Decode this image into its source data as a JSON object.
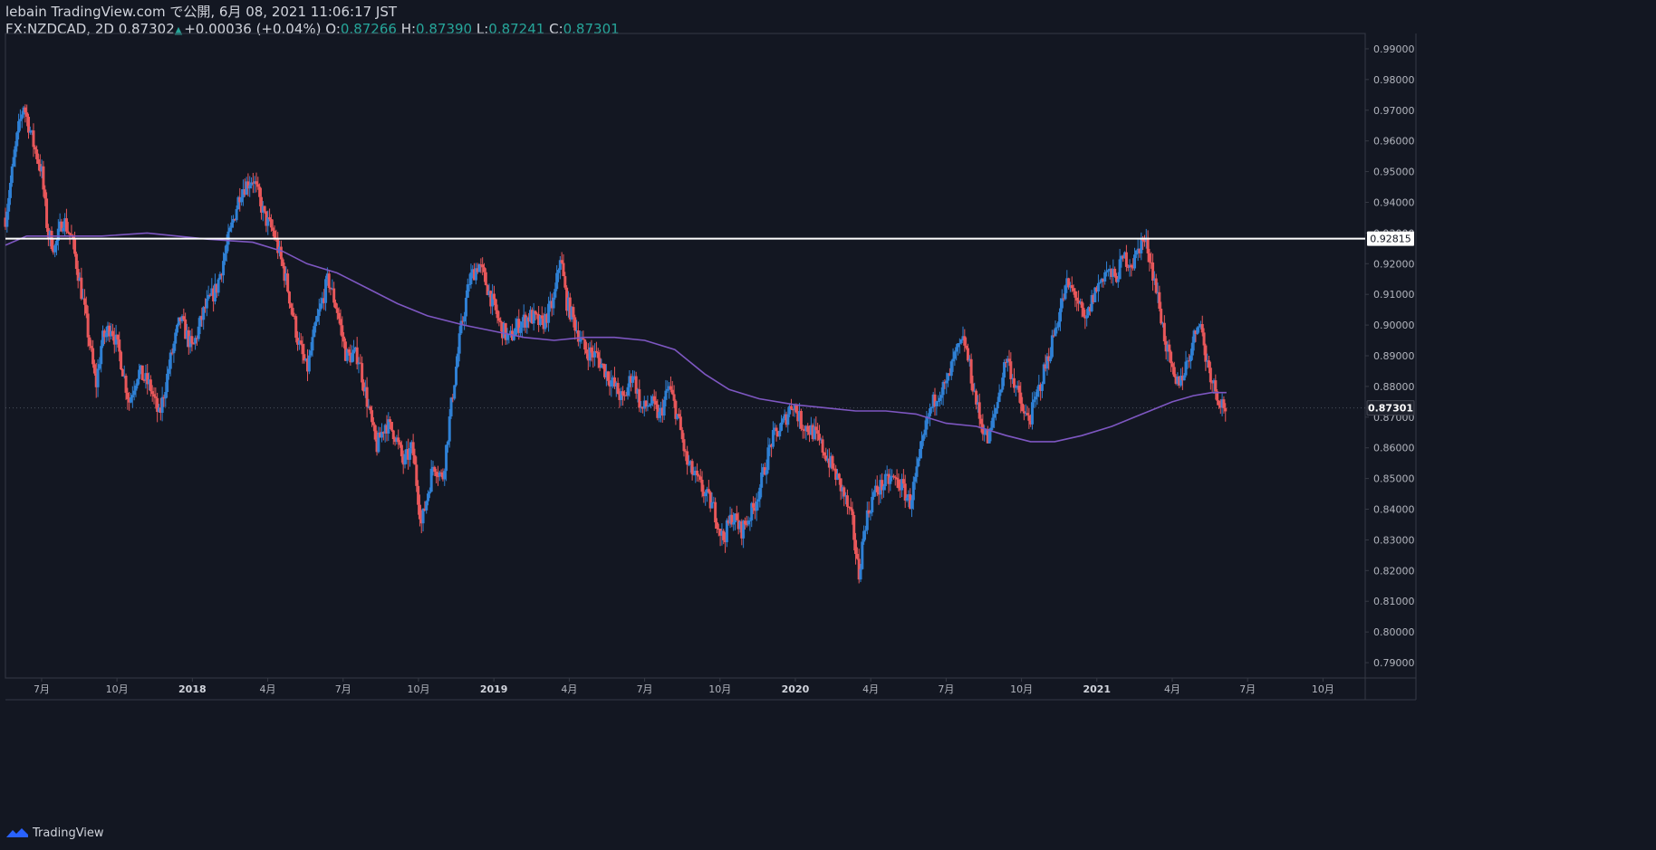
{
  "header": {
    "publish_line": "lebain TradingView.com で公開, 6月 08, 2021 11:06:17 JST",
    "symbol": "FX:NZDCAD, 2D",
    "last": "0.87302",
    "change": "+0.00036 (+0.04%)",
    "o_label": "O:",
    "o_value": "0.87266",
    "h_label": "H:",
    "h_value": "0.87390",
    "l_label": "L:",
    "l_value": "0.87241",
    "c_label": "C:",
    "c_value": "0.87301"
  },
  "footer": {
    "brand": "TradingView"
  },
  "chart_data": {
    "type": "candlestick",
    "symbol": "FX:NZDCAD",
    "interval": "2D",
    "ylim": [
      0.785,
      0.995
    ],
    "y_ticks": [
      0.79,
      0.8,
      0.81,
      0.82,
      0.83,
      0.84,
      0.85,
      0.86,
      0.87,
      0.88,
      0.89,
      0.9,
      0.91,
      0.92,
      0.93,
      0.94,
      0.95,
      0.96,
      0.97,
      0.98,
      0.99
    ],
    "y_tick_labels": [
      "0.79000",
      "0.80000",
      "0.81000",
      "0.82000",
      "0.83000",
      "0.84000",
      "0.85000",
      "0.86000",
      "0.87000",
      "0.88000",
      "0.89000",
      "0.90000",
      "0.91000",
      "0.92000",
      "0.93000",
      "0.94000",
      "0.95000",
      "0.96000",
      "0.97000",
      "0.98000",
      "0.99000"
    ],
    "x_ticks": [
      {
        "t": 2017.5,
        "label": "7月",
        "bold": false
      },
      {
        "t": 2017.75,
        "label": "10月",
        "bold": false
      },
      {
        "t": 2018.0,
        "label": "2018",
        "bold": true
      },
      {
        "t": 2018.25,
        "label": "4月",
        "bold": false
      },
      {
        "t": 2018.5,
        "label": "7月",
        "bold": false
      },
      {
        "t": 2018.75,
        "label": "10月",
        "bold": false
      },
      {
        "t": 2019.0,
        "label": "2019",
        "bold": true
      },
      {
        "t": 2019.25,
        "label": "4月",
        "bold": false
      },
      {
        "t": 2019.5,
        "label": "7月",
        "bold": false
      },
      {
        "t": 2019.75,
        "label": "10月",
        "bold": false
      },
      {
        "t": 2020.0,
        "label": "2020",
        "bold": true
      },
      {
        "t": 2020.25,
        "label": "4月",
        "bold": false
      },
      {
        "t": 2020.5,
        "label": "7月",
        "bold": false
      },
      {
        "t": 2020.75,
        "label": "10月",
        "bold": false
      },
      {
        "t": 2021.0,
        "label": "2021",
        "bold": true
      },
      {
        "t": 2021.25,
        "label": "4月",
        "bold": false
      },
      {
        "t": 2021.5,
        "label": "7月",
        "bold": false
      },
      {
        "t": 2021.75,
        "label": "10月",
        "bold": false
      }
    ],
    "xlim": [
      2017.38,
      2021.89
    ],
    "price_path": [
      [
        2017.38,
        0.935
      ],
      [
        2017.42,
        0.962
      ],
      [
        2017.44,
        0.972
      ],
      [
        2017.47,
        0.96
      ],
      [
        2017.5,
        0.95
      ],
      [
        2017.52,
        0.93
      ],
      [
        2017.545,
        0.925
      ],
      [
        2017.57,
        0.935
      ],
      [
        2017.6,
        0.928
      ],
      [
        2017.625,
        0.915
      ],
      [
        2017.65,
        0.9
      ],
      [
        2017.68,
        0.88
      ],
      [
        2017.7,
        0.895
      ],
      [
        2017.73,
        0.9
      ],
      [
        2017.76,
        0.89
      ],
      [
        2017.79,
        0.875
      ],
      [
        2017.82,
        0.885
      ],
      [
        2017.86,
        0.88
      ],
      [
        2017.89,
        0.87
      ],
      [
        2017.93,
        0.89
      ],
      [
        2017.96,
        0.902
      ],
      [
        2018.0,
        0.892
      ],
      [
        2018.04,
        0.905
      ],
      [
        2018.08,
        0.912
      ],
      [
        2018.12,
        0.928
      ],
      [
        2018.16,
        0.944
      ],
      [
        2018.2,
        0.948
      ],
      [
        2018.24,
        0.935
      ],
      [
        2018.27,
        0.93
      ],
      [
        2018.31,
        0.915
      ],
      [
        2018.35,
        0.895
      ],
      [
        2018.38,
        0.885
      ],
      [
        2018.41,
        0.9
      ],
      [
        2018.45,
        0.915
      ],
      [
        2018.48,
        0.905
      ],
      [
        2018.51,
        0.89
      ],
      [
        2018.55,
        0.89
      ],
      [
        2018.58,
        0.875
      ],
      [
        2018.61,
        0.86
      ],
      [
        2018.64,
        0.868
      ],
      [
        2018.67,
        0.865
      ],
      [
        2018.7,
        0.855
      ],
      [
        2018.73,
        0.86
      ],
      [
        2018.76,
        0.835
      ],
      [
        2018.8,
        0.855
      ],
      [
        2018.83,
        0.85
      ],
      [
        2018.86,
        0.875
      ],
      [
        2018.89,
        0.898
      ],
      [
        2018.92,
        0.915
      ],
      [
        2018.95,
        0.92
      ],
      [
        2018.98,
        0.912
      ],
      [
        2019.02,
        0.9
      ],
      [
        2019.05,
        0.895
      ],
      [
        2019.08,
        0.9
      ],
      [
        2019.12,
        0.903
      ],
      [
        2019.16,
        0.9
      ],
      [
        2019.2,
        0.908
      ],
      [
        2019.22,
        0.923
      ],
      [
        2019.24,
        0.908
      ],
      [
        2019.27,
        0.9
      ],
      [
        2019.3,
        0.892
      ],
      [
        2019.34,
        0.89
      ],
      [
        2019.37,
        0.885
      ],
      [
        2019.4,
        0.88
      ],
      [
        2019.43,
        0.875
      ],
      [
        2019.46,
        0.885
      ],
      [
        2019.49,
        0.872
      ],
      [
        2019.52,
        0.875
      ],
      [
        2019.55,
        0.87
      ],
      [
        2019.58,
        0.88
      ],
      [
        2019.61,
        0.87
      ],
      [
        2019.64,
        0.855
      ],
      [
        2019.67,
        0.85
      ],
      [
        2019.7,
        0.845
      ],
      [
        2019.73,
        0.84
      ],
      [
        2019.76,
        0.83
      ],
      [
        2019.79,
        0.838
      ],
      [
        2019.82,
        0.833
      ],
      [
        2019.86,
        0.84
      ],
      [
        2019.89,
        0.85
      ],
      [
        2019.92,
        0.862
      ],
      [
        2019.96,
        0.868
      ],
      [
        2019.99,
        0.875
      ],
      [
        2020.02,
        0.868
      ],
      [
        2020.06,
        0.865
      ],
      [
        2020.1,
        0.858
      ],
      [
        2020.13,
        0.852
      ],
      [
        2020.16,
        0.845
      ],
      [
        2020.19,
        0.835
      ],
      [
        2020.21,
        0.818
      ],
      [
        2020.23,
        0.835
      ],
      [
        2020.26,
        0.845
      ],
      [
        2020.29,
        0.848
      ],
      [
        2020.32,
        0.85
      ],
      [
        2020.35,
        0.848
      ],
      [
        2020.38,
        0.842
      ],
      [
        2020.41,
        0.855
      ],
      [
        2020.44,
        0.87
      ],
      [
        2020.47,
        0.878
      ],
      [
        2020.5,
        0.88
      ],
      [
        2020.53,
        0.89
      ],
      [
        2020.56,
        0.895
      ],
      [
        2020.58,
        0.885
      ],
      [
        2020.61,
        0.87
      ],
      [
        2020.64,
        0.862
      ],
      [
        2020.67,
        0.875
      ],
      [
        2020.7,
        0.89
      ],
      [
        2020.73,
        0.88
      ],
      [
        2020.76,
        0.87
      ],
      [
        2020.78,
        0.87
      ],
      [
        2020.81,
        0.88
      ],
      [
        2020.84,
        0.89
      ],
      [
        2020.87,
        0.902
      ],
      [
        2020.9,
        0.913
      ],
      [
        2020.93,
        0.91
      ],
      [
        2020.96,
        0.9
      ],
      [
        2020.99,
        0.91
      ],
      [
        2021.03,
        0.918
      ],
      [
        2021.06,
        0.915
      ],
      [
        2021.09,
        0.922
      ],
      [
        2021.12,
        0.92
      ],
      [
        2021.15,
        0.928
      ],
      [
        2021.17,
        0.925
      ],
      [
        2021.2,
        0.91
      ],
      [
        2021.23,
        0.893
      ],
      [
        2021.26,
        0.88
      ],
      [
        2021.29,
        0.885
      ],
      [
        2021.32,
        0.895
      ],
      [
        2021.34,
        0.903
      ],
      [
        2021.36,
        0.89
      ],
      [
        2021.39,
        0.88
      ],
      [
        2021.41,
        0.875
      ],
      [
        2021.43,
        0.873
      ]
    ],
    "moving_average": [
      [
        2017.38,
        0.926
      ],
      [
        2017.45,
        0.929
      ],
      [
        2017.55,
        0.929
      ],
      [
        2017.7,
        0.929
      ],
      [
        2017.85,
        0.93
      ],
      [
        2017.95,
        0.929
      ],
      [
        2018.05,
        0.928
      ],
      [
        2018.2,
        0.927
      ],
      [
        2018.3,
        0.924
      ],
      [
        2018.38,
        0.92
      ],
      [
        2018.48,
        0.917
      ],
      [
        2018.58,
        0.912
      ],
      [
        2018.68,
        0.907
      ],
      [
        2018.78,
        0.903
      ],
      [
        2018.9,
        0.9
      ],
      [
        2019.0,
        0.898
      ],
      [
        2019.1,
        0.896
      ],
      [
        2019.2,
        0.895
      ],
      [
        2019.3,
        0.896
      ],
      [
        2019.4,
        0.896
      ],
      [
        2019.5,
        0.895
      ],
      [
        2019.6,
        0.892
      ],
      [
        2019.7,
        0.884
      ],
      [
        2019.78,
        0.879
      ],
      [
        2019.88,
        0.876
      ],
      [
        2020.0,
        0.874
      ],
      [
        2020.1,
        0.873
      ],
      [
        2020.2,
        0.872
      ],
      [
        2020.3,
        0.872
      ],
      [
        2020.4,
        0.871
      ],
      [
        2020.5,
        0.868
      ],
      [
        2020.6,
        0.867
      ],
      [
        2020.7,
        0.864
      ],
      [
        2020.78,
        0.862
      ],
      [
        2020.86,
        0.862
      ],
      [
        2020.95,
        0.864
      ],
      [
        2021.05,
        0.867
      ],
      [
        2021.15,
        0.871
      ],
      [
        2021.25,
        0.875
      ],
      [
        2021.32,
        0.877
      ],
      [
        2021.38,
        0.878
      ],
      [
        2021.43,
        0.878
      ]
    ],
    "horizontal_line": {
      "value": 0.92815,
      "label": "0.92815"
    },
    "last_price": {
      "value": 0.87301,
      "label": "0.87301"
    },
    "colors": {
      "background": "#131722",
      "up": "#2f80d4",
      "down": "#e8575a",
      "ma": "#7e57c2",
      "hline": "#ffffff",
      "axis_text": "#b2b5be",
      "border": "#363a45",
      "last_label_bg": "#1e222d"
    }
  }
}
